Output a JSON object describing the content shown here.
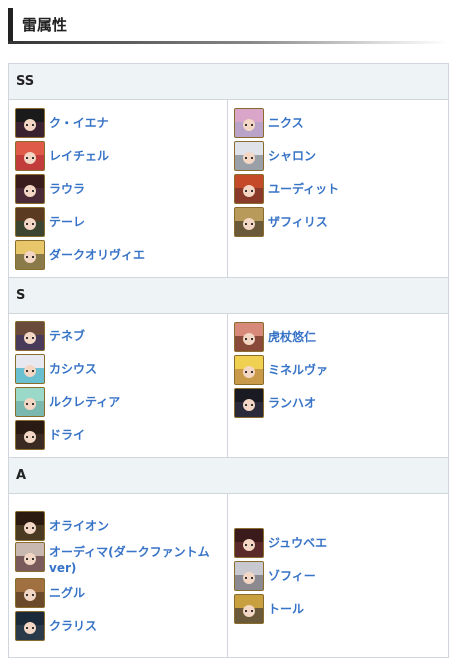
{
  "title": "雷属性",
  "tiers": [
    {
      "name": "SS",
      "left": [
        {
          "name": "ク・イエナ",
          "icon": "character-portrait-icon",
          "bg": "#3a2230",
          "hair": "#1a1a1a"
        },
        {
          "name": "レイチェル",
          "icon": "character-portrait-icon",
          "bg": "#c23c3c",
          "hair": "#e05a4a"
        },
        {
          "name": "ラウラ",
          "icon": "character-portrait-icon",
          "bg": "#4a2a36",
          "hair": "#3b1c1c"
        },
        {
          "name": "テーレ",
          "icon": "character-portrait-icon",
          "bg": "#3c4530",
          "hair": "#5a3a20"
        },
        {
          "name": "ダークオリヴィエ",
          "icon": "character-portrait-icon",
          "bg": "#8a7a4a",
          "hair": "#e8c66a"
        }
      ],
      "right": [
        {
          "name": "ニクス",
          "icon": "character-portrait-icon",
          "bg": "#b9a3c9",
          "hair": "#d9a5c8"
        },
        {
          "name": "シャロン",
          "icon": "character-portrait-icon",
          "bg": "#9aa0a8",
          "hair": "#dfe2e8"
        },
        {
          "name": "ユーディット",
          "icon": "character-portrait-icon",
          "bg": "#8a3a2a",
          "hair": "#c44a2a"
        },
        {
          "name": "ザフィリス",
          "icon": "character-portrait-icon",
          "bg": "#6a5a3a",
          "hair": "#b89a5a"
        }
      ]
    },
    {
      "name": "S",
      "left": [
        {
          "name": "テネブ",
          "icon": "character-portrait-icon",
          "bg": "#4a3a5a",
          "hair": "#6a4a3a"
        },
        {
          "name": "カシウス",
          "icon": "character-portrait-icon",
          "bg": "#6ac0d0",
          "hair": "#e8e8f0"
        },
        {
          "name": "ルクレティア",
          "icon": "character-portrait-icon",
          "bg": "#7ab8b0",
          "hair": "#9ad8c8"
        },
        {
          "name": "ドライ",
          "icon": "character-portrait-icon",
          "bg": "#3a2a22",
          "hair": "#2a1a14"
        }
      ],
      "right": [
        {
          "name": "虎杖悠仁",
          "icon": "character-portrait-icon",
          "bg": "#8a4a3a",
          "hair": "#d88a7a"
        },
        {
          "name": "ミネルヴァ",
          "icon": "character-portrait-icon",
          "bg": "#c89a4a",
          "hair": "#f0d050"
        },
        {
          "name": "ランハオ",
          "icon": "character-portrait-icon",
          "bg": "#2a2a3a",
          "hair": "#1a1a22"
        }
      ]
    },
    {
      "name": "A",
      "left": [
        {
          "name": "オライオン",
          "icon": "character-portrait-icon",
          "bg": "#4a3a22",
          "hair": "#2a1a10"
        },
        {
          "name": "オーディマ(ダークファントムver)",
          "icon": "character-portrait-icon",
          "bg": "#7a5a5a",
          "hair": "#c8b8b0",
          "wrap": true
        },
        {
          "name": "ニグル",
          "icon": "character-portrait-icon",
          "bg": "#6a4a2a",
          "hair": "#a07040"
        },
        {
          "name": "クラリス",
          "icon": "character-portrait-icon",
          "bg": "#2a3a4a",
          "hair": "#1a2a3a"
        }
      ],
      "right": [
        {
          "name": "ジュウベエ",
          "icon": "character-portrait-icon",
          "bg": "#5a2a2a",
          "hair": "#3a1a1a"
        },
        {
          "name": "ゾフィー",
          "icon": "character-portrait-icon",
          "bg": "#8a8a90",
          "hair": "#c8c8d0"
        },
        {
          "name": "トール",
          "icon": "character-portrait-icon",
          "bg": "#6a5a3a",
          "hair": "#c8a040"
        }
      ]
    }
  ]
}
